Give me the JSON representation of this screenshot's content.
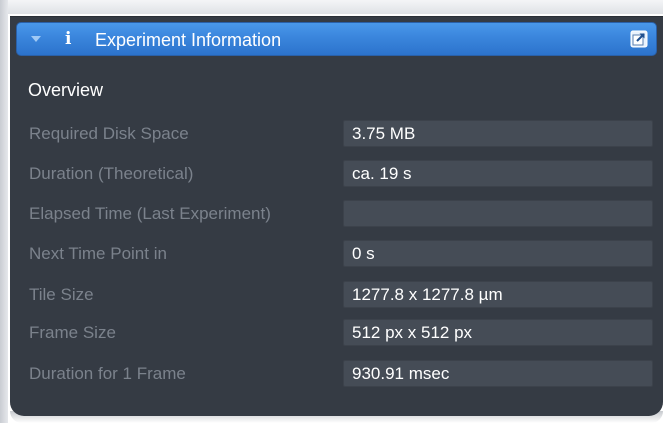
{
  "panel": {
    "title": "Experiment Information",
    "info_glyph": "i",
    "icons": {
      "collapse": "chevron-down-icon",
      "info": "info-icon",
      "popout": "popout-icon"
    },
    "colors": {
      "header_blue": "#3a85dc",
      "panel_bg": "#353b44",
      "field_bg": "#454c56",
      "label_gray": "#7b828c",
      "value_white": "#ffffff"
    }
  },
  "overview": {
    "title": "Overview",
    "rows": [
      {
        "label": "Required Disk Space",
        "value": "3.75 MB"
      },
      {
        "label": "Duration (Theoretical)",
        "value": "ca. 19 s"
      },
      {
        "label": "Elapsed Time (Last Experiment)",
        "value": ""
      },
      {
        "label": "Next Time Point in",
        "value": "0 s"
      },
      {
        "label": "Tile Size",
        "value": "1277.8 x 1277.8 µm"
      },
      {
        "label": "Frame Size",
        "value": "512 px x 512 px"
      },
      {
        "label": "Duration for 1 Frame",
        "value": "930.91 msec"
      }
    ]
  }
}
